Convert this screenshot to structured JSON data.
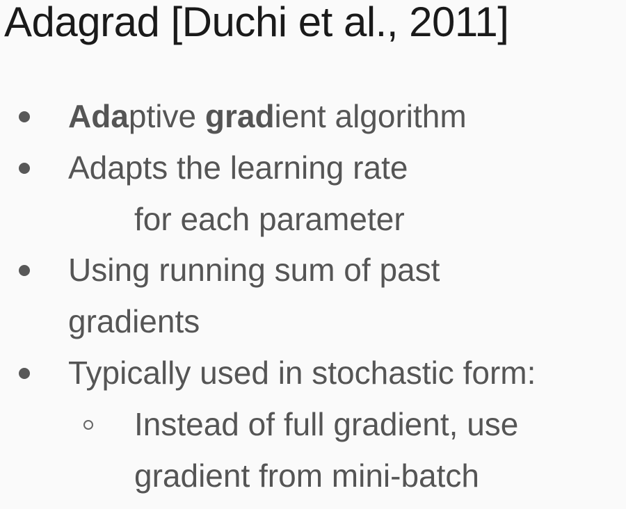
{
  "slide": {
    "title": "Adagrad [Duchi et al., 2011]",
    "bullets": [
      {
        "parts": [
          {
            "text": "Ada",
            "bold": true
          },
          {
            "text": "ptive ",
            "bold": false
          },
          {
            "text": "grad",
            "bold": true
          },
          {
            "text": "ient algorithm",
            "bold": false
          }
        ]
      },
      {
        "line1": "Adapts the learning rate",
        "line2": "for each parameter"
      },
      {
        "line1": "Using running sum of past",
        "line2": "gradients"
      },
      {
        "line1": "Typically used in stochastic form:",
        "sub": {
          "line1": "Instead of full gradient, use",
          "line2": "gradient from mini-batch"
        }
      }
    ]
  }
}
